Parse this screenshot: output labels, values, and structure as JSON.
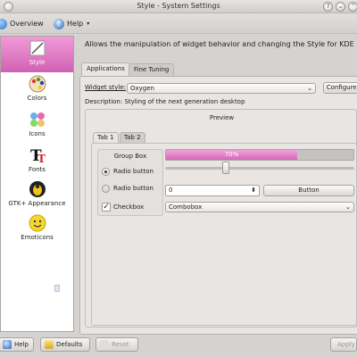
{
  "window": {
    "title": "Style - System Settings"
  },
  "toolbar": {
    "overview_label": "Overview",
    "help_label": "Help"
  },
  "sidebar": {
    "items": [
      {
        "label": "Style",
        "icon": "style-icon",
        "active": true
      },
      {
        "label": "Colors",
        "icon": "colors-icon",
        "active": false
      },
      {
        "label": "Icons",
        "icon": "icons-icon",
        "active": false
      },
      {
        "label": "Fonts",
        "icon": "fonts-icon",
        "active": false
      },
      {
        "label": "GTK+ Appearance",
        "icon": "gtk-icon",
        "active": false
      },
      {
        "label": "Emoticons",
        "icon": "emoticons-icon",
        "active": false
      }
    ]
  },
  "module": {
    "description": "Allows the manipulation of widget behavior and changing the Style for KDE"
  },
  "tabs": {
    "applications": "Applications",
    "fine_tuning": "Fine Tuning"
  },
  "widget_style": {
    "label": "Widget style:",
    "value": "Oxygen",
    "configure_label": "Configure...",
    "description": "Description: Styling of the next generation desktop"
  },
  "preview": {
    "title": "Preview",
    "tab1": "Tab 1",
    "tab2": "Tab 2",
    "group_box_title": "Group Box",
    "radio1": "Radio button",
    "radio2": "Radio button",
    "checkbox": "Checkbox",
    "progress_percent": 70,
    "progress_label": "70%",
    "slider_fraction": 0.32,
    "spin_value": "0",
    "button_label": "Button",
    "combobox_label": "Combobox"
  },
  "bottom": {
    "help_label": "Help",
    "defaults_label": "Defaults",
    "reset_label": "Reset",
    "apply_label": "Apply"
  },
  "colors": {
    "accent": "#d96bb9",
    "accent_light": "#f19ad8"
  }
}
